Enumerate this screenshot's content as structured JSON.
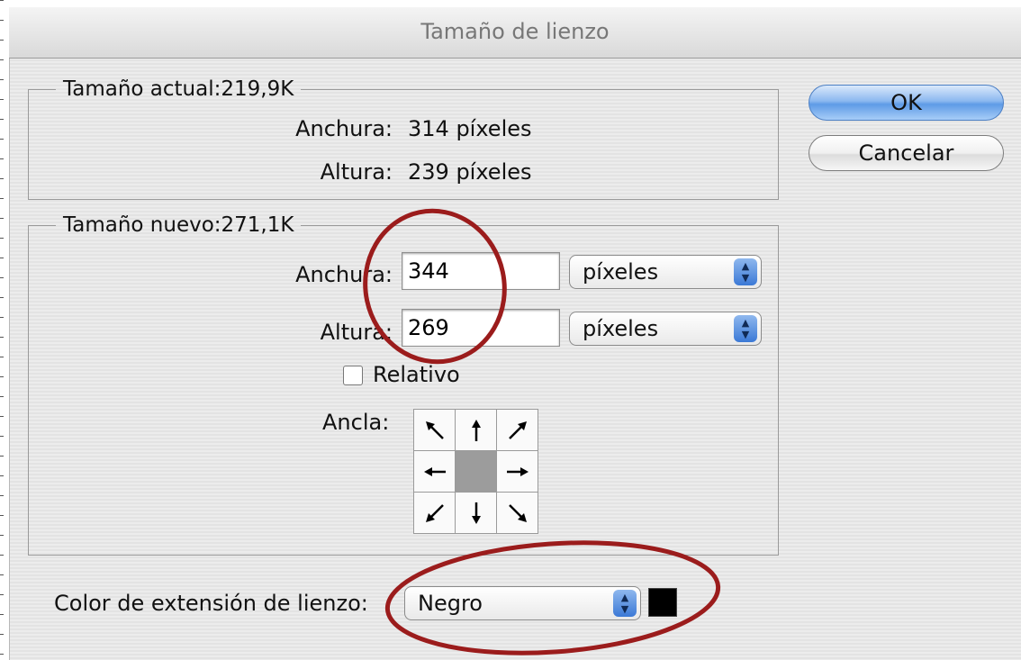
{
  "dialog": {
    "title": "Tamaño de lienzo"
  },
  "current_size": {
    "legend": "Tamaño actual:219,9K",
    "width_label": "Anchura:",
    "width_value": "314 píxeles",
    "height_label": "Altura:",
    "height_value": "239 píxeles"
  },
  "new_size": {
    "legend": "Tamaño nuevo:271,1K",
    "width_label": "Anchura:",
    "width_value": "344",
    "width_unit": "píxeles",
    "height_label": "Altura:",
    "height_value": "269",
    "height_unit": "píxeles",
    "relative_label": "Relativo",
    "relative_checked": false,
    "anchor_label": "Ancla:",
    "anchor_selected": "center"
  },
  "extension": {
    "label": "Color de extensión de lienzo:",
    "value": "Negro",
    "swatch_color": "#000000"
  },
  "buttons": {
    "ok": "OK",
    "cancel": "Cancelar"
  },
  "colors": {
    "annotation": "#9b1c1c",
    "popup_arrows": "#3b79d6",
    "ok_button": "#7fb0ef"
  }
}
